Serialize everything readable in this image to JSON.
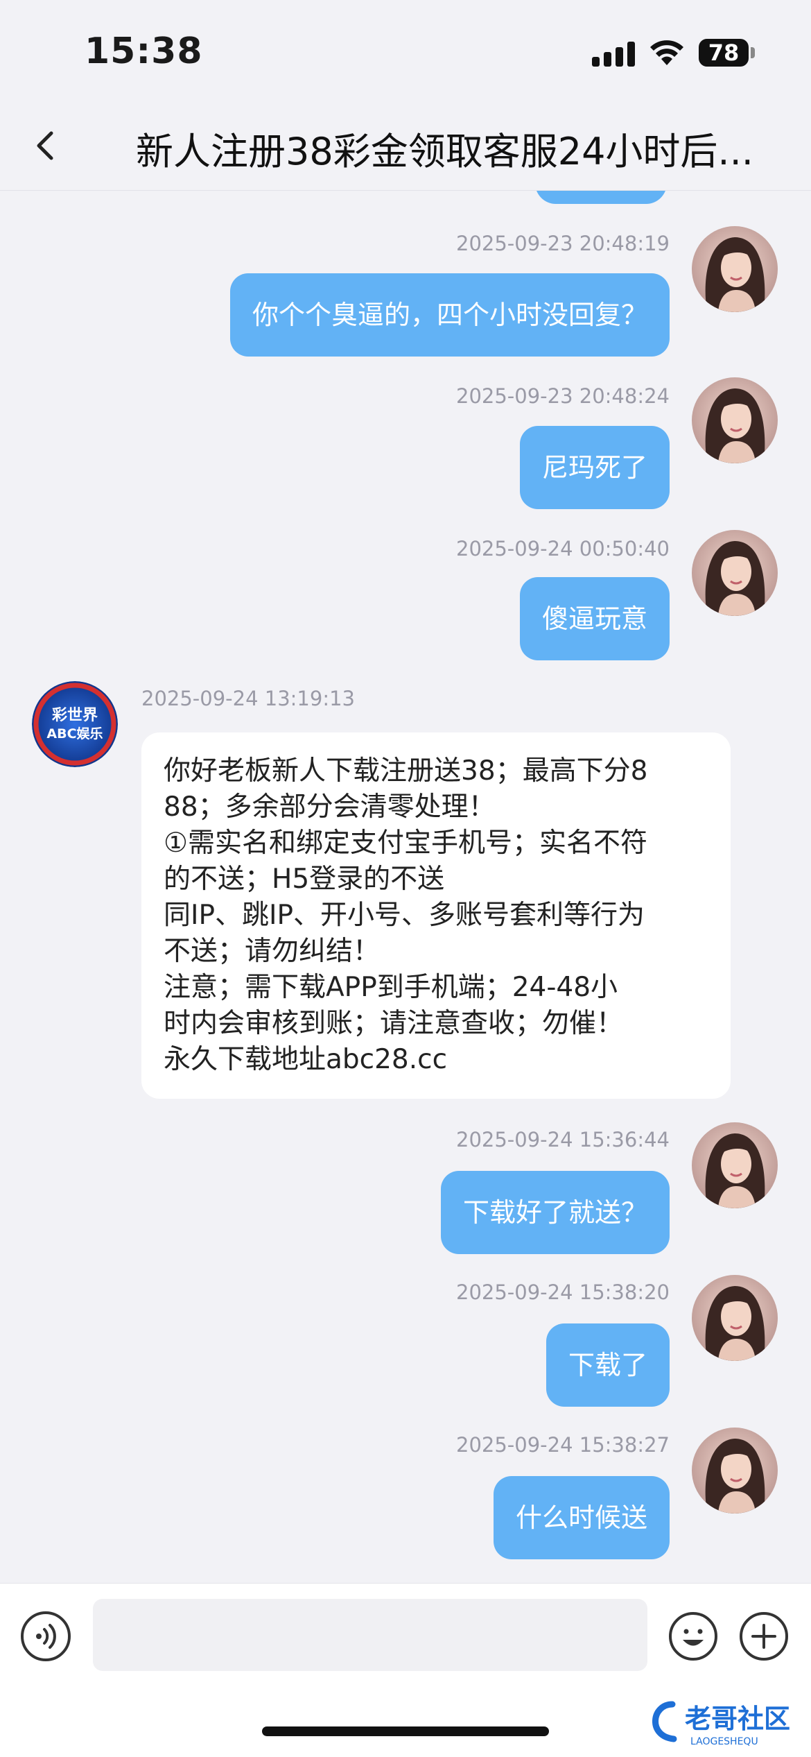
{
  "status_bar": {
    "time": "15:38",
    "battery": "78"
  },
  "nav": {
    "title": "新人注册38彩金领取客服24小时后..."
  },
  "messages": [
    {
      "side": "right",
      "time": "2025-09-23 20:48:19",
      "text": "你个个臭逼的，四个小时没回复？"
    },
    {
      "side": "right",
      "time": "2025-09-23 20:48:24",
      "text": "尼玛死了"
    },
    {
      "side": "right",
      "time": "2025-09-24 00:50:40",
      "text": "傻逼玩意"
    },
    {
      "side": "left",
      "time": "2025-09-24 13:19:13",
      "avatar_text": [
        "彩世界",
        "ABC娱乐"
      ],
      "lines": [
        "你好老板新人下载注册送38；最高下分8",
        "88；多余部分会清零处理！",
        "①需实名和绑定支付宝手机号；实名不符",
        "的不送；H5登录的不送",
        "同IP、跳IP、开小号、多账号套利等行为",
        "不送；请勿纠结！",
        "注意；需下载APP到手机端；24-48小",
        "时内会审核到账；请注意查收；勿催！",
        "永久下载地址abc28.cc"
      ]
    },
    {
      "side": "right",
      "time": "2025-09-24 15:36:44",
      "text": "下载好了就送？"
    },
    {
      "side": "right",
      "time": "2025-09-24 15:38:20",
      "text": "下载了"
    },
    {
      "side": "right",
      "time": "2025-09-24 15:38:27",
      "text": "什么时候送"
    }
  ],
  "input": {
    "placeholder": ""
  },
  "watermark": {
    "text": "老哥社区",
    "subtext": "LAOGESHEQU"
  },
  "colors": {
    "outgoing_bubble": "#62b2f5",
    "incoming_bubble": "#ffffff",
    "background": "#f2f2f6"
  }
}
